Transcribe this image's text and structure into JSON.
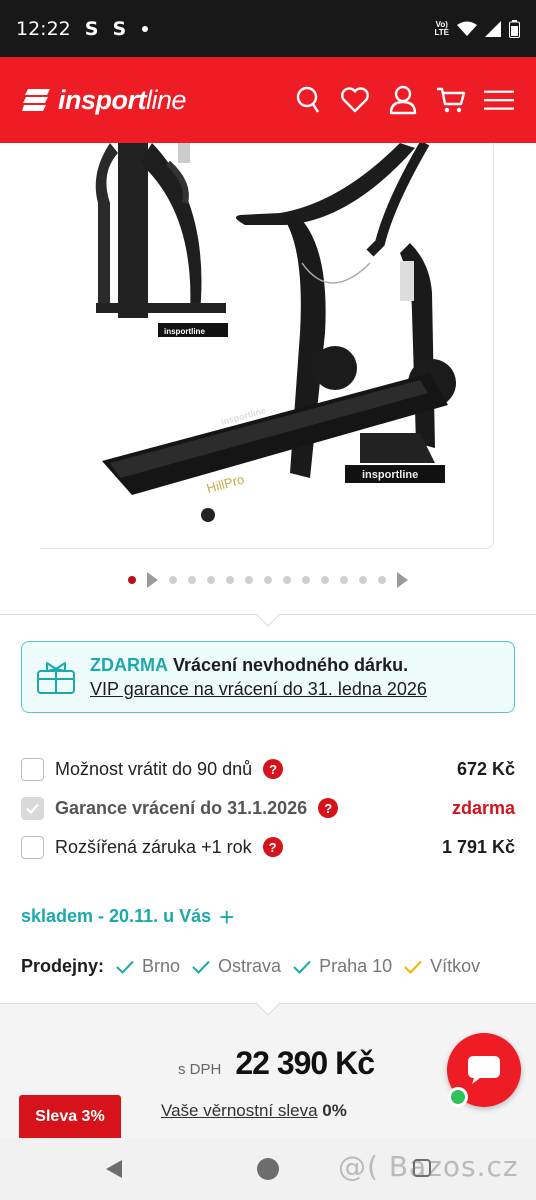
{
  "status_bar": {
    "time": "12:22",
    "s1": "S",
    "s2": "S",
    "volte_top": "Vo)",
    "volte_bottom": "LTE"
  },
  "header": {
    "logo_bold": "insport",
    "logo_light": "line"
  },
  "product": {
    "image_label": "HillPro",
    "base_brand": "insportline",
    "deck_brand": "insportline",
    "side_brand": "insportline"
  },
  "carousel": {
    "dot_count": 14,
    "active_index": 0
  },
  "promo": {
    "free_label": "ZDARMA",
    "title": "Vrácení nevhodného dárku.",
    "link": "VIP garance na vrácení do 31. ledna 2026"
  },
  "options": [
    {
      "label": "Možnost vrátit do 90 dnů",
      "price": "672 Kč",
      "checked": false
    },
    {
      "label": "Garance vrácení do 31.1.2026",
      "price": "zdarma",
      "checked": true
    },
    {
      "label": "Rozšířená záruka +1 rok",
      "price": "1 791 Kč",
      "checked": false
    }
  ],
  "help_mark": "?",
  "stock": {
    "text": "skladem - 20.11. u Vás",
    "plus": "+"
  },
  "stores": {
    "label": "Prodejny:",
    "items": [
      {
        "name": "Brno",
        "color": "#1aa9ad"
      },
      {
        "name": "Ostrava",
        "color": "#1aa9ad"
      },
      {
        "name": "Praha 10",
        "color": "#1aa9ad"
      },
      {
        "name": "Vítkov",
        "color": "#f0b400"
      }
    ]
  },
  "price": {
    "dph_label": "s DPH",
    "value": "22 390 Kč"
  },
  "discount": {
    "badge": "Sleva 3%",
    "loyalty_link": "Vaše věrnostní sleva",
    "loyalty_value": "0%"
  },
  "watermark": "@( Bazos.cz",
  "colors": {
    "brand_red": "#ee1c25",
    "teal": "#1aa9ad",
    "online": "#2fc15b"
  }
}
